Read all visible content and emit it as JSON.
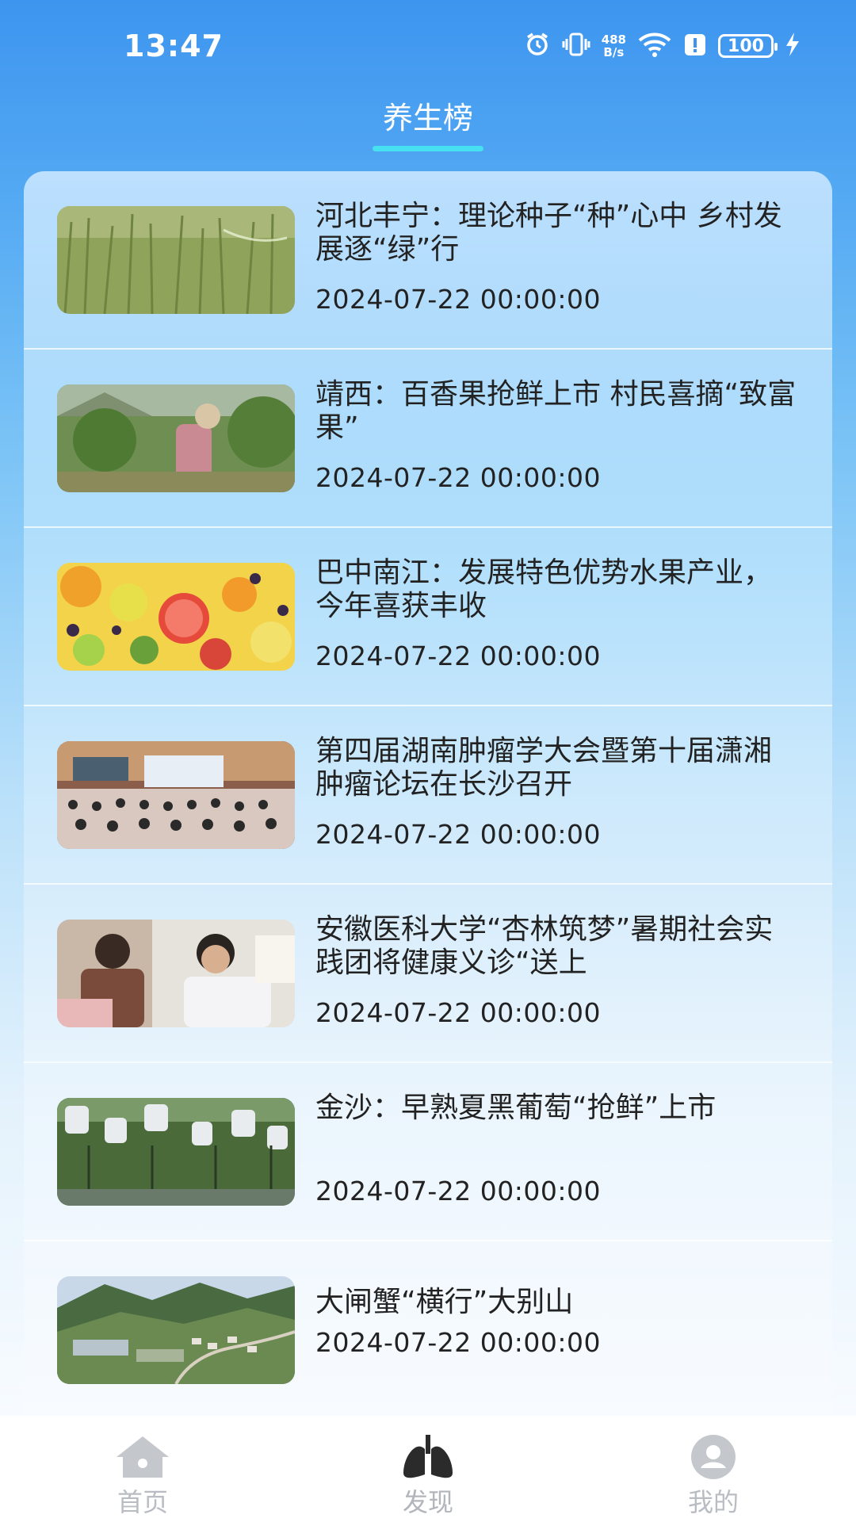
{
  "status_bar": {
    "time": "13:47",
    "net_speed_top": "488",
    "net_speed_bottom": "B/s",
    "battery": "100",
    "icons": [
      "alarm-icon",
      "vibrate-icon",
      "wifi-icon",
      "alert-icon",
      "battery-icon",
      "charging-icon"
    ]
  },
  "header": {
    "title": "养生榜",
    "underline_color": "#46e0f0"
  },
  "news": [
    {
      "title": "河北丰宁：理论种子“种”心中 乡村发展逐“绿”行",
      "date": "2024-07-22 00:00:00",
      "image": "wheat-field"
    },
    {
      "title": "靖西：百香果抢鲜上市 村民喜摘“致富果”",
      "date": "2024-07-22 00:00:00",
      "image": "fruit-picking"
    },
    {
      "title": "巴中南江：发展特色优势水果产业，今年喜获丰收",
      "date": "2024-07-22 00:00:00",
      "image": "fruit-platter"
    },
    {
      "title": "第四届湖南肿瘤学大会暨第十届潇湘肿瘤论坛在长沙召开",
      "date": "2024-07-22 00:00:00",
      "image": "conference-hall"
    },
    {
      "title": "安徽医科大学“杏林筑梦”暑期社会实践团将健康义诊“送上",
      "date": "2024-07-22 00:00:00",
      "image": "health-clinic"
    },
    {
      "title": "金沙：早熟夏黑葡萄“抢鲜”上市",
      "date": "2024-07-22 00:00:00",
      "image": "grape-vineyard"
    },
    {
      "title": "大闸蟹“横行”大别山",
      "date": "2024-07-22 00:00:00",
      "image": "mountain-village"
    }
  ],
  "bottom_nav": [
    {
      "label": "首页",
      "icon": "home-icon",
      "active": false
    },
    {
      "label": "发现",
      "icon": "lungs-icon",
      "active": true
    },
    {
      "label": "我的",
      "icon": "user-icon",
      "active": false
    }
  ],
  "colors": {
    "primary_blue": "#3d95ef",
    "nav_inactive": "#b9bcc2",
    "nav_active_icon": "#2b2b2b",
    "text": "#222222"
  }
}
